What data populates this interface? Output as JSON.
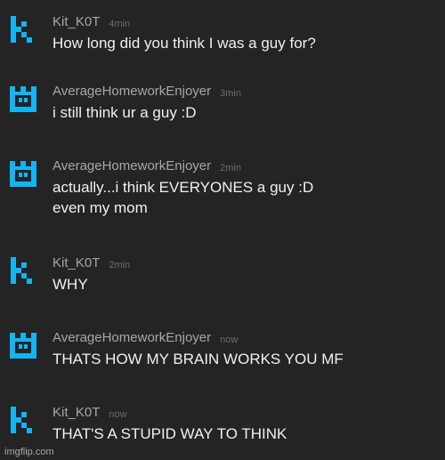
{
  "messages": [
    {
      "author": "Kit_K0T",
      "avatar": "kit-avatar-icon",
      "time": "4min",
      "lines": [
        "How long did you think I was a guy for?"
      ]
    },
    {
      "author": "AverageHomeworkEnjoyer",
      "avatar": "castle-avatar-icon",
      "time": "3min",
      "lines": [
        "i still think ur a guy :D"
      ]
    },
    {
      "author": "AverageHomeworkEnjoyer",
      "avatar": "castle-avatar-icon",
      "time": "2min",
      "lines": [
        "actually...i think EVERYONES a guy :D",
        "even my mom"
      ]
    },
    {
      "author": "Kit_K0T",
      "avatar": "kit-avatar-icon",
      "time": "2min",
      "lines": [
        "WHY"
      ]
    },
    {
      "author": "AverageHomeworkEnjoyer",
      "avatar": "castle-avatar-icon",
      "time": "now",
      "lines": [
        "THATS HOW MY BRAIN WORKS YOU MF"
      ]
    },
    {
      "author": "Kit_K0T",
      "avatar": "kit-avatar-icon",
      "time": "now",
      "lines": [
        "THAT'S A STUPID WAY TO THINK"
      ]
    }
  ],
  "watermark": "imgflip.com",
  "colors": {
    "background": "#242424",
    "avatar": "#12b4f2",
    "author": "#a7a7a7",
    "time": "#6c6c6c",
    "text": "#f0f0f0"
  }
}
